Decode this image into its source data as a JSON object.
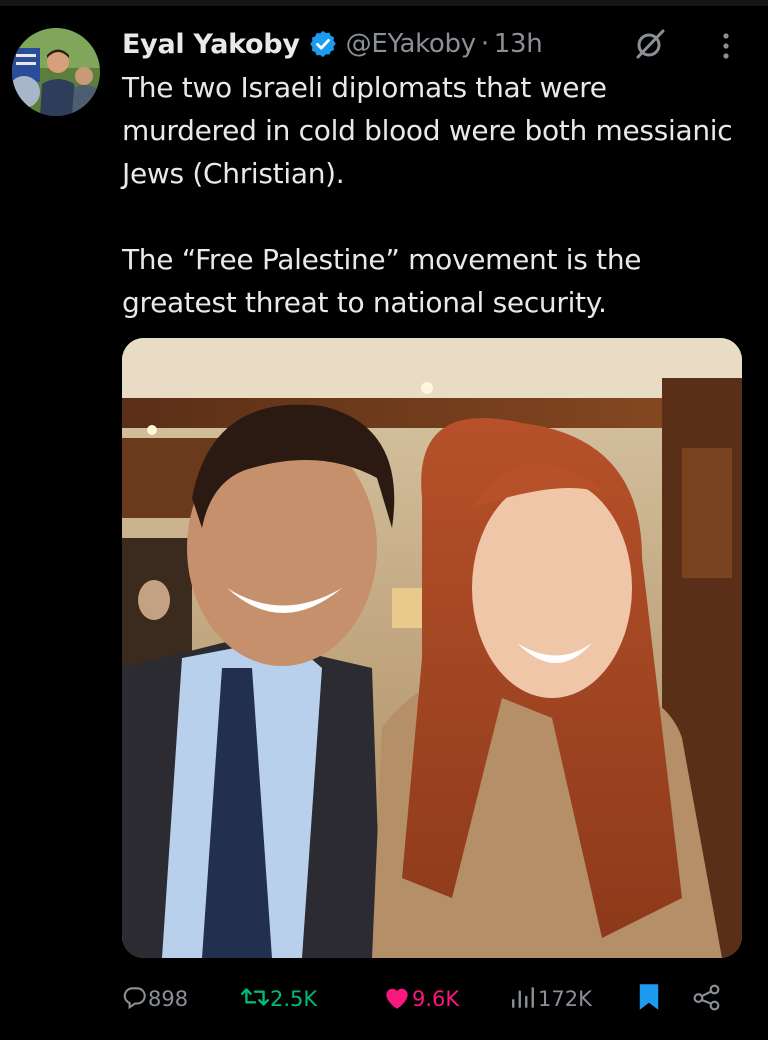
{
  "author": {
    "name": "Eyal Yakoby",
    "handle": "@EYakoby",
    "separator": "·",
    "time": "13h",
    "verified_icon": "verified-badge-icon"
  },
  "tweet": {
    "paragraphs": [
      "The two Israeli diplomats that were murdered in cold blood were both messianic Jews (Christian).",
      "The “Free Palestine” movement is the greatest threat to national security."
    ]
  },
  "actions": {
    "replies": "898",
    "reposts": "2.5K",
    "likes": "9.6K",
    "views": "172K"
  },
  "icons": {
    "reply": "reply-icon",
    "repost": "repost-icon",
    "like": "heart-icon",
    "views": "views-icon",
    "bookmark": "bookmark-icon",
    "share": "share-icon",
    "grok": "grok-icon",
    "more": "more-icon"
  },
  "colors": {
    "background": "#000000",
    "text": "#e7e9ea",
    "secondary": "#8b9096",
    "verified": "#1d9bf0",
    "repost_active": "#00ba7c",
    "like_active": "#f91880",
    "bookmark_active": "#1d9bf0"
  }
}
